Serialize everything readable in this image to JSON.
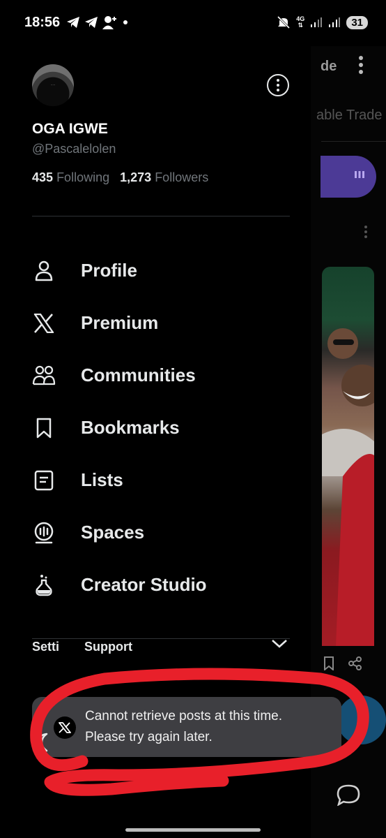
{
  "status_bar": {
    "time": "18:56",
    "network": "4G",
    "battery": "31"
  },
  "profile": {
    "display_name": "OGA IGWE",
    "handle": "@Pascalelolen",
    "following_count": "435",
    "following_label": "Following",
    "followers_count": "1,273",
    "followers_label": "Followers"
  },
  "nav": {
    "items": [
      {
        "label": "Profile",
        "icon": "person-icon"
      },
      {
        "label": "Premium",
        "icon": "x-logo-icon"
      },
      {
        "label": "Communities",
        "icon": "people-icon"
      },
      {
        "label": "Bookmarks",
        "icon": "bookmark-icon"
      },
      {
        "label": "Lists",
        "icon": "list-icon"
      },
      {
        "label": "Spaces",
        "icon": "spaces-icon"
      },
      {
        "label": "Creator Studio",
        "icon": "flask-icon"
      }
    ]
  },
  "settings": {
    "label_left": "Setti",
    "label_right": "Support"
  },
  "toast": {
    "line1": "Cannot retrieve posts at this time.",
    "line2": "Please try again later."
  },
  "background_app": {
    "title_fragment": "de",
    "tab_fragment": "able Trade"
  },
  "colors": {
    "background": "#000000",
    "text": "#e7e9ea",
    "muted": "#71767b",
    "toast_bg": "#3e3e42",
    "annotation_red": "#e8202a",
    "accent_purple": "#4c3a96"
  }
}
